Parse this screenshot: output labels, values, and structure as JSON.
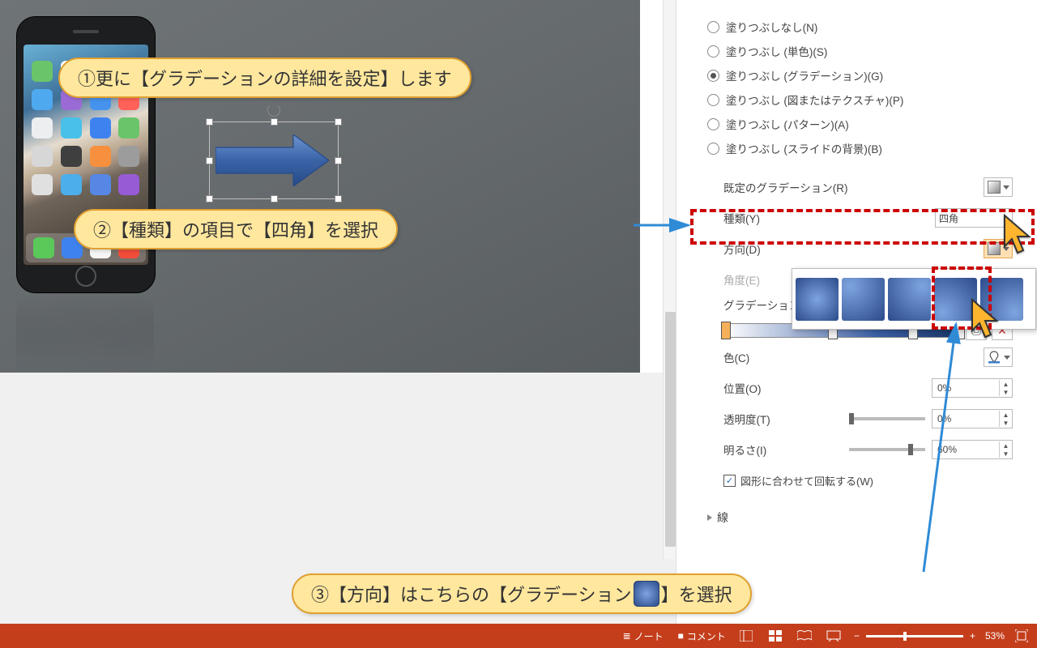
{
  "fill_options": {
    "none": "塗りつぶしなし(N)",
    "solid": "塗りつぶし (単色)(S)",
    "gradient": "塗りつぶし (グラデーション)(G)",
    "picture": "塗りつぶし (図またはテクスチャ)(P)",
    "pattern": "塗りつぶし (パターン)(A)",
    "slide_bg": "塗りつぶし (スライドの背景)(B)"
  },
  "labels": {
    "preset": "既定のグラデーション(R)",
    "type": "種類(Y)",
    "type_value": "四角",
    "direction": "方向(D)",
    "angle": "角度(E)",
    "stops": "グラデーションの分岐点",
    "color": "色(C)",
    "position": "位置(O)",
    "transparency": "透明度(T)",
    "brightness": "明るさ(I)",
    "rotate_with_shape": "図形に合わせて回転する(W)",
    "line_section": "線"
  },
  "values": {
    "position": "0%",
    "transparency": "0%",
    "brightness": "60%"
  },
  "callouts": {
    "c1": "①更に【グラデーションの詳細を設定】します",
    "c2": "②【種類】の項目で【四角】を選択",
    "c3a": "③【方向】はこちらの【グラデーション",
    "c3b": "】を選択"
  },
  "statusbar": {
    "notes": "ノート",
    "comments": "コメント",
    "zoom": "53%"
  },
  "app_colors": [
    "#6ac46a",
    "#fefefe",
    "#3c7ff0",
    "#ff8a3c",
    "#4fa9ee",
    "#9a6bd4",
    "#4693ed",
    "#ff6259",
    "#eceef0",
    "#49c0e8",
    "#3e82ef",
    "#6ac46a",
    "#d7d7d8",
    "#3f3f3f",
    "#f68f3e",
    "#9c9c9c",
    "#e0e0e0",
    "#4caeea",
    "#5687e4",
    "#985bd6"
  ],
  "dock_colors": [
    "#5ac95a",
    "#3e82ef",
    "#f5f5f5",
    "#f14d3a"
  ]
}
